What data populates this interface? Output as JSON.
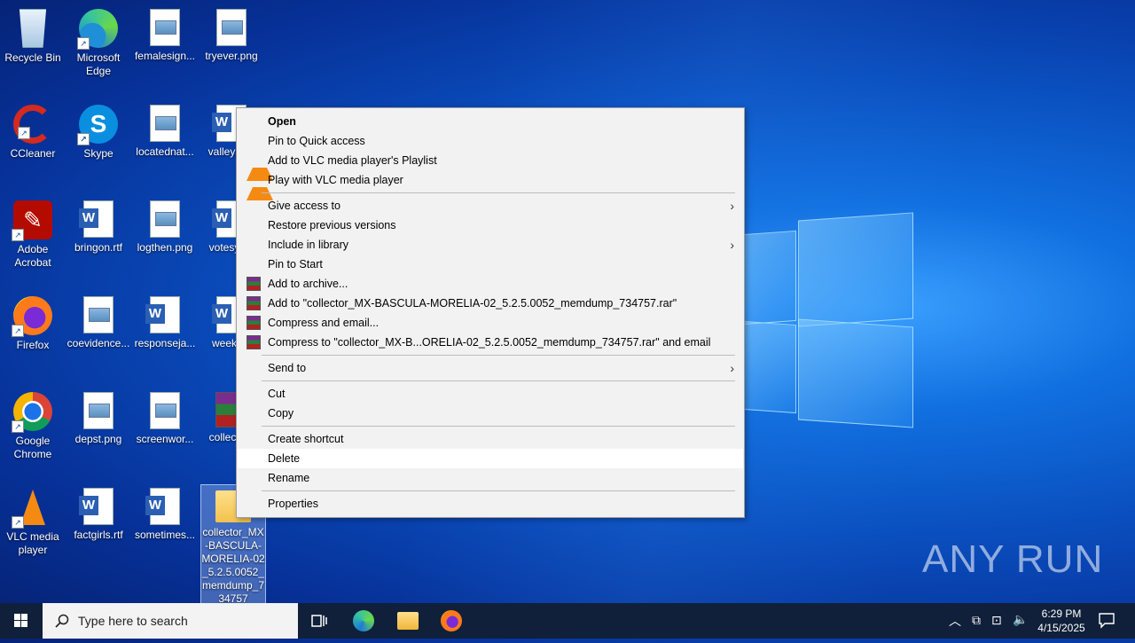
{
  "desktop_icons": [
    {
      "label": "Recycle Bin",
      "kind": "recycle"
    },
    {
      "label": "Microsoft Edge",
      "kind": "edge"
    },
    {
      "label": "femalesign...",
      "kind": "png"
    },
    {
      "label": "tryever.png",
      "kind": "png"
    },
    {
      "label": "CCleaner",
      "kind": "ccleaner"
    },
    {
      "label": "Skype",
      "kind": "skype"
    },
    {
      "label": "locatednat...",
      "kind": "png"
    },
    {
      "label": "valleysc...",
      "kind": "word"
    },
    {
      "label": "Adobe Acrobat",
      "kind": "acrobat"
    },
    {
      "label": "bringon.rtf",
      "kind": "word"
    },
    {
      "label": "logthen.png",
      "kind": "png"
    },
    {
      "label": "votesys...",
      "kind": "word"
    },
    {
      "label": "Firefox",
      "kind": "firefox"
    },
    {
      "label": "coevidence...",
      "kind": "png"
    },
    {
      "label": "responseja...",
      "kind": "word"
    },
    {
      "label": "weekx...",
      "kind": "word"
    },
    {
      "label": "Google Chrome",
      "kind": "chrome"
    },
    {
      "label": "depst.png",
      "kind": "png"
    },
    {
      "label": "screenwor...",
      "kind": "png"
    },
    {
      "label": "collecto...",
      "kind": "rar"
    },
    {
      "label": "VLC media player",
      "kind": "vlc"
    },
    {
      "label": "factgirls.rtf",
      "kind": "word"
    },
    {
      "label": "sometimes...",
      "kind": "word"
    },
    {
      "label": "collector_MX-BASCULA-MORELIA-02_5.2.5.0052_memdump_734757",
      "kind": "folder"
    }
  ],
  "context_menu": {
    "items": [
      {
        "label": "Open",
        "bold": true
      },
      {
        "label": "Pin to Quick access"
      },
      {
        "label": "Add to VLC media player's Playlist",
        "icon": "vlc"
      },
      {
        "label": "Play with VLC media player",
        "icon": "vlc"
      },
      {
        "label": "Give access to",
        "submenu": true
      },
      {
        "label": "Restore previous versions"
      },
      {
        "label": "Include in library",
        "submenu": true
      },
      {
        "label": "Pin to Start"
      },
      {
        "label": "Add to archive...",
        "icon": "rar"
      },
      {
        "label": "Add to \"collector_MX-BASCULA-MORELIA-02_5.2.5.0052_memdump_734757.rar\"",
        "icon": "rar"
      },
      {
        "label": "Compress and email...",
        "icon": "rar"
      },
      {
        "label": "Compress to \"collector_MX-B...ORELIA-02_5.2.5.0052_memdump_734757.rar\" and email",
        "icon": "rar"
      },
      {
        "label": "Send to",
        "submenu": true
      },
      {
        "label": "Cut"
      },
      {
        "label": "Copy"
      },
      {
        "label": "Create shortcut"
      },
      {
        "label": "Delete",
        "highlighted": true
      },
      {
        "label": "Rename"
      },
      {
        "label": "Properties"
      }
    ]
  },
  "taskbar": {
    "search_placeholder": "Type here to search",
    "time": "6:29 PM",
    "date": "4/15/2025"
  },
  "watermark": "ANY RUN",
  "colors": {
    "taskbar": "#10203a",
    "menu_bg": "#f2f2f2",
    "accent": "#0a4fbf"
  }
}
